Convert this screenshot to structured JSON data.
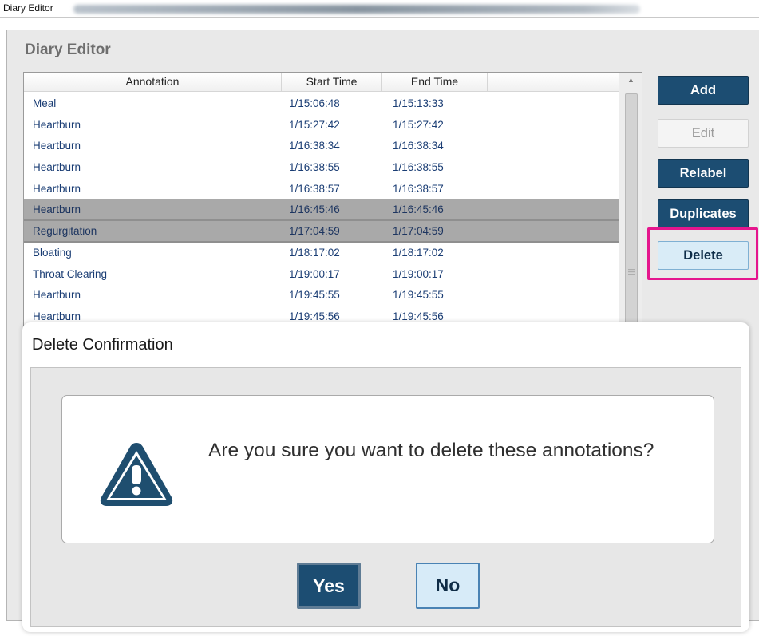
{
  "window": {
    "title": "Diary Editor"
  },
  "editor": {
    "heading": "Diary Editor",
    "columns": [
      "Annotation",
      "Start Time",
      "End Time"
    ],
    "rows": [
      {
        "annotation": "Meal",
        "start": "1/15:06:48",
        "end": "1/15:13:33",
        "selected": false
      },
      {
        "annotation": "Heartburn",
        "start": "1/15:27:42",
        "end": "1/15:27:42",
        "selected": false
      },
      {
        "annotation": "Heartburn",
        "start": "1/16:38:34",
        "end": "1/16:38:34",
        "selected": false
      },
      {
        "annotation": "Heartburn",
        "start": "1/16:38:55",
        "end": "1/16:38:55",
        "selected": false
      },
      {
        "annotation": "Heartburn",
        "start": "1/16:38:57",
        "end": "1/16:38:57",
        "selected": false
      },
      {
        "annotation": "Heartburn",
        "start": "1/16:45:46",
        "end": "1/16:45:46",
        "selected": true
      },
      {
        "annotation": "Regurgitation",
        "start": "1/17:04:59",
        "end": "1/17:04:59",
        "selected": true
      },
      {
        "annotation": "Bloating",
        "start": "1/18:17:02",
        "end": "1/18:17:02",
        "selected": false
      },
      {
        "annotation": "Throat Clearing",
        "start": "1/19:00:17",
        "end": "1/19:00:17",
        "selected": false
      },
      {
        "annotation": "Heartburn",
        "start": "1/19:45:55",
        "end": "1/19:45:55",
        "selected": false
      },
      {
        "annotation": "Heartburn",
        "start": "1/19:45:56",
        "end": "1/19:45:56",
        "selected": false
      }
    ],
    "buttons": {
      "add": "Add",
      "edit": "Edit",
      "relabel": "Relabel",
      "duplicates": "Duplicates",
      "delete": "Delete"
    },
    "highlight_color": "#e5168d"
  },
  "dialog": {
    "title": "Delete Confirmation",
    "message": "Are you sure you want to delete these annotations?",
    "icon": "warning-triangle-icon",
    "yes_label": "Yes",
    "no_label": "No"
  },
  "colors": {
    "primary": "#1c4d72",
    "row_text": "#1a3d74",
    "selected_row": "#a9a9a9"
  }
}
